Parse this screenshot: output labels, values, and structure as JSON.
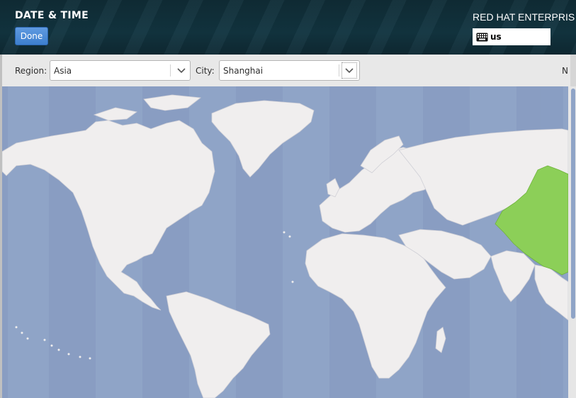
{
  "header": {
    "title": "DATE & TIME",
    "done_label": "Done",
    "product_name": "RED HAT ENTERPRIS",
    "keyboard_layout": "us"
  },
  "toolbar": {
    "region_label": "Region:",
    "region_value": "Asia",
    "city_label": "City:",
    "city_value": "Shanghai",
    "network_time_label": "N"
  },
  "map": {
    "selected_timezone_color": "#8ccf58",
    "land_color": "#f0eeee",
    "ocean_color": "#8fa4c7"
  }
}
